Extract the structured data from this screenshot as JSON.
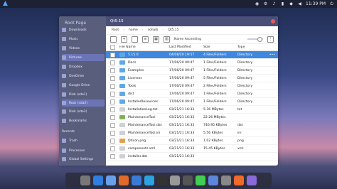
{
  "topbar": {
    "time": "11:39 PM",
    "battery": "battery-icon"
  },
  "window": {
    "title": "Qt5.15",
    "root_label": "Root Page"
  },
  "sidebar": {
    "title": "Root Page",
    "items": [
      {
        "label": "Downloads"
      },
      {
        "label": "Music"
      },
      {
        "label": "Videos"
      },
      {
        "label": "Pictures"
      },
      {
        "label": "Dropbox"
      },
      {
        "label": "OneDrive"
      },
      {
        "label": "Google Drive"
      },
      {
        "label": "Disk (sda1)"
      },
      {
        "label": "Root (sda2)"
      },
      {
        "label": "Disk (sda3)"
      },
      {
        "label": "Bookmarks"
      },
      {
        "label": "Recents"
      },
      {
        "label": "Trash"
      },
      {
        "label": "Processes"
      },
      {
        "label": "Global Settings"
      }
    ]
  },
  "path": {
    "crumbs": [
      "Root",
      "home",
      "sohaib",
      "Qt5.15"
    ]
  },
  "toolbar": {
    "sort_label": "Name Ascending"
  },
  "table": {
    "headers": {
      "name": "File Name",
      "modified": "Last Modified",
      "size": "Size",
      "type": "Type"
    },
    "rows": [
      {
        "name": "5.15.0",
        "modified": "04/08/20 19:57",
        "size": "4 Files/Folders",
        "type": "Directory",
        "kind": "folder",
        "selected": true
      },
      {
        "name": "Docs",
        "modified": "17/06/20 09:47",
        "size": "1 Files/Folders",
        "type": "Directory",
        "kind": "folder"
      },
      {
        "name": "Examples",
        "modified": "17/06/20 09:47",
        "size": "1 Files/Folders",
        "type": "Directory",
        "kind": "folder"
      },
      {
        "name": "Licenses",
        "modified": "17/06/20 09:47",
        "size": "5 Files/Folders",
        "type": "Directory",
        "kind": "folder"
      },
      {
        "name": "Tools",
        "modified": "17/06/20 09:47",
        "size": "2 Files/Folders",
        "type": "Directory",
        "kind": "folder"
      },
      {
        "name": "dist",
        "modified": "17/06/20 09:47",
        "size": "1 Files/Folders",
        "type": "Directory",
        "kind": "folder"
      },
      {
        "name": "InstallerResources",
        "modified": "17/06/20 09:47",
        "size": "1 Files/Folders",
        "type": "Directory",
        "kind": "folder"
      },
      {
        "name": "InstallationLog.txt",
        "modified": "03/21/21 16:33",
        "size": "5.36 MBytes",
        "type": "txt",
        "kind": "file"
      },
      {
        "name": "MaintenanceTool",
        "modified": "03/21/21 16:33",
        "size": "22.26 MBytes",
        "type": "",
        "kind": "exe"
      },
      {
        "name": "MaintenanceTool.dat",
        "modified": "03/21/21 16:33",
        "size": "746.95 KBytes",
        "type": "dat",
        "kind": "file"
      },
      {
        "name": "MaintenanceTool.ini",
        "modified": "03/21/21 16:33",
        "size": "5.56 KBytes",
        "type": "ini",
        "kind": "file"
      },
      {
        "name": "Qticon.png",
        "modified": "03/21/21 16:33",
        "size": "1.02 KBytes",
        "type": "png",
        "kind": "img"
      },
      {
        "name": "components.xml",
        "modified": "03/21/21 16:33",
        "size": "15.45 KBytes",
        "type": "xml",
        "kind": "file"
      },
      {
        "name": "installer.dat",
        "modified": "03/21/21 16:33",
        "size": "",
        "type": "",
        "kind": "file"
      }
    ]
  },
  "dock": {
    "apps": [
      "settings-icon",
      "app-store-icon",
      "finder-icon",
      "firefox-icon",
      "mail-icon",
      "telegram-icon",
      "terminal-icon",
      "system-icon",
      "display-icon",
      "qt-icon",
      "files-icon",
      "calendar-icon",
      "brave-icon",
      "theme-icon"
    ]
  }
}
